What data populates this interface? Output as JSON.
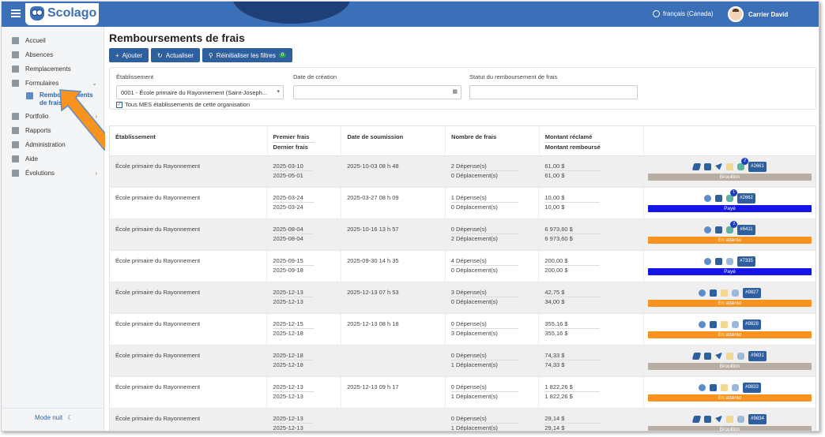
{
  "app": {
    "logo": "Scolago",
    "language": "français (Canada)",
    "user": "Carrier David"
  },
  "sidebar": {
    "items": [
      {
        "label": "Accueil",
        "icon": "home-icon"
      },
      {
        "label": "Absences",
        "icon": "users-icon"
      },
      {
        "label": "Remplacements",
        "icon": "swap-icon"
      },
      {
        "label": "Formulaires",
        "icon": "forms-icon"
      },
      {
        "label": "Portfolio",
        "icon": "trophy-icon"
      },
      {
        "label": "Rapports",
        "icon": "report-icon"
      },
      {
        "label": "Administration",
        "icon": "gear-icon"
      },
      {
        "label": "Aide",
        "icon": "help-icon"
      },
      {
        "label": "Évolutions",
        "icon": "sprout-icon"
      }
    ],
    "sub_item": "Remboursements de frais",
    "night_mode": "Mode nuit"
  },
  "page": {
    "title": "Remboursements de frais",
    "buttons": {
      "add": "Ajouter",
      "refresh": "Actualiser",
      "reset": "Réinitialiser les filtres",
      "reset_count": "0"
    }
  },
  "filters": {
    "establishment_label": "Établissement",
    "establishment_value": "0001 - École primaire du Rayonnement (Saint-Joseph...",
    "created_label": "Date de création",
    "status_label": "Statut du remboursement de frais",
    "all_checkbox": "Tous MES établissements de cette organisation"
  },
  "table": {
    "headers": {
      "establishment": "Établissement",
      "first_fee": "Premier frais",
      "last_fee": "Dernier frais",
      "submitted": "Date de soumission",
      "count": "Nombre de frais",
      "claimed": "Montant réclamé",
      "reimbursed": "Montant remboursé"
    },
    "rows": [
      {
        "est": "École primaire du Rayonnement",
        "first": "2025-03-10",
        "last": "2025-05-01",
        "sub": "2025-10-03 08 h 48",
        "dep": "2 Dépense(s)",
        "depl": "0 Déplacement(s)",
        "claimed": "61,00 $",
        "reimb": "61,00 $",
        "icons": [
          "edit",
          "copy",
          "send",
          "trash",
          "comment"
        ],
        "notif": "2",
        "id": "#2661",
        "status": "Brouillon",
        "color": "#b8aea4"
      },
      {
        "est": "École primaire du Rayonnement",
        "first": "2025-03-24",
        "last": "2025-03-24",
        "sub": "2025-03-27 08 h 09",
        "dep": "1 Dépense(s)",
        "depl": "0 Déplacement(s)",
        "claimed": "10,00 $",
        "reimb": "10,00 $",
        "icons": [
          "eye",
          "copy",
          "comment"
        ],
        "notif": "1",
        "id": "#2662",
        "status": "Payé",
        "color": "#1515e8"
      },
      {
        "est": "École primaire du Rayonnement",
        "first": "2025-08-04",
        "last": "2025-08-04",
        "sub": "2025-10-16 13 h 57",
        "dep": "0 Dépense(s)",
        "depl": "2 Déplacement(s)",
        "claimed": "6 973,60 $",
        "reimb": "6 973,60 $",
        "icons": [
          "eye",
          "copy",
          "comment"
        ],
        "notif": "2",
        "id": "#6411",
        "status": "En attente",
        "color": "#f7931e"
      },
      {
        "est": "École primaire du Rayonnement",
        "first": "2025-09-15",
        "last": "2025-09-18",
        "sub": "2025-09-30 14 h 35",
        "dep": "4 Dépense(s)",
        "depl": "0 Déplacement(s)",
        "claimed": "200,00 $",
        "reimb": "200,00 $",
        "icons": [
          "eye",
          "copy",
          "comment"
        ],
        "notif": "",
        "id": "#7335",
        "status": "Payé",
        "color": "#1515e8"
      },
      {
        "est": "École primaire du Rayonnement",
        "first": "2025-12-13",
        "last": "2025-12-13",
        "sub": "2025-12-13 07 h 53",
        "dep": "3 Dépense(s)",
        "depl": "0 Déplacement(s)",
        "claimed": "42,75 $",
        "reimb": "34,00 $",
        "icons": [
          "eye",
          "copy",
          "trash",
          "comment"
        ],
        "notif": "",
        "id": "#9827",
        "status": "En attente",
        "color": "#f7931e"
      },
      {
        "est": "École primaire du Rayonnement",
        "first": "2025-12-15",
        "last": "2025-12-18",
        "sub": "2025-12-13 08 h 18",
        "dep": "0 Dépense(s)",
        "depl": "3 Déplacement(s)",
        "claimed": "355,16 $",
        "reimb": "355,16 $",
        "icons": [
          "eye",
          "copy",
          "trash",
          "comment"
        ],
        "notif": "",
        "id": "#9828",
        "status": "En attente",
        "color": "#f7931e"
      },
      {
        "est": "École primaire du Rayonnement",
        "first": "2025-12-18",
        "last": "2025-12-18",
        "sub": "",
        "dep": "0 Dépense(s)",
        "depl": "1 Déplacement(s)",
        "claimed": "74,33 $",
        "reimb": "74,33 $",
        "icons": [
          "edit",
          "copy",
          "send",
          "trash",
          "comment"
        ],
        "notif": "",
        "id": "#9831",
        "status": "Brouillon",
        "color": "#b8aea4"
      },
      {
        "est": "École primaire du Rayonnement",
        "first": "2025-12-13",
        "last": "2025-12-13",
        "sub": "2025-12-13 09 h 17",
        "dep": "0 Dépense(s)",
        "depl": "1 Déplacement(s)",
        "claimed": "1 822,26 $",
        "reimb": "1 822,26 $",
        "icons": [
          "eye",
          "copy",
          "trash",
          "comment"
        ],
        "notif": "",
        "id": "#9833",
        "status": "En attente",
        "color": "#f7931e"
      },
      {
        "est": "École primaire du Rayonnement",
        "first": "2025-12-13",
        "last": "2025-12-13",
        "sub": "",
        "dep": "0 Dépense(s)",
        "depl": "1 Déplacement(s)",
        "claimed": "29,14 $",
        "reimb": "29,14 $",
        "icons": [
          "edit",
          "copy",
          "send",
          "trash",
          "comment"
        ],
        "notif": "",
        "id": "#9834",
        "status": "Brouillon",
        "color": "#b8aea4"
      }
    ]
  }
}
